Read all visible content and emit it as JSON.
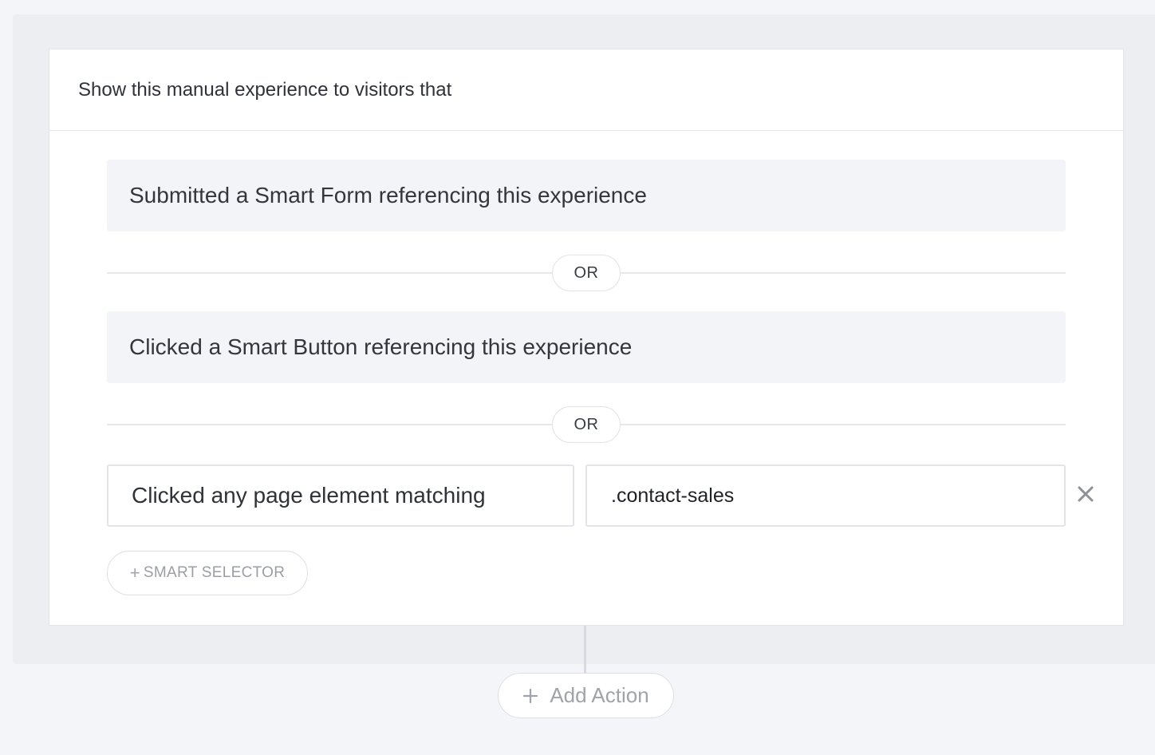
{
  "header": {
    "title": "Show this manual experience to visitors that"
  },
  "conditions": [
    {
      "label": "Submitted a Smart Form referencing this experience"
    },
    {
      "label": "Clicked a Smart Button referencing this experience"
    }
  ],
  "divider_label": "OR",
  "selector_rule": {
    "type_label": "Clicked any page element matching",
    "value": ".contact-sales"
  },
  "buttons": {
    "smart_selector": "SMART SELECTOR",
    "smart_selector_plus": "+",
    "add_action": "Add Action"
  },
  "icons": {
    "remove": "close-icon",
    "add": "plus-icon"
  }
}
